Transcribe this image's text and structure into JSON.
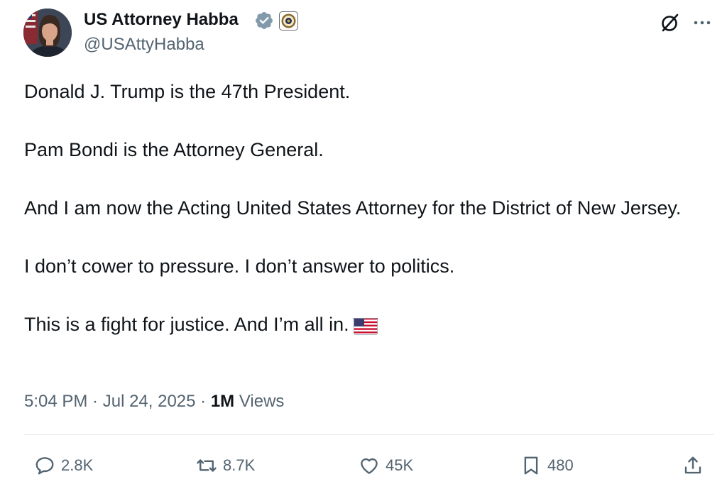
{
  "author": {
    "display_name": "US Attorney Habba",
    "handle": "@USAttyHabba"
  },
  "post": {
    "paragraphs": [
      "Donald J. Trump is the 47th President.",
      "Pam Bondi is the Attorney General.",
      "And I am now the Acting United States Attorney for the District of New Jersey.",
      "I don’t cower to pressure. I don’t answer to politics.",
      "This is a fight for justice. And I’m all in."
    ]
  },
  "meta": {
    "time": "5:04 PM",
    "separator": " · ",
    "date": "Jul 24, 2025",
    "views_count": "1M",
    "views_label": "Views"
  },
  "actions": {
    "replies": "2.8K",
    "reposts": "8.7K",
    "likes": "45K",
    "bookmarks": "480"
  },
  "icons": {
    "verified": "verified-badge-icon",
    "affiliation": "doj-seal-icon",
    "grok": "grok-icon",
    "more": "more-icon",
    "flag": "us-flag-icon",
    "reply": "reply-icon",
    "repost": "repost-icon",
    "like": "heart-icon",
    "bookmark": "bookmark-icon",
    "share": "share-icon"
  },
  "colors": {
    "text": "#0f1419",
    "secondary": "#536471",
    "verified": "#829aab",
    "divider": "#e7e9ea"
  }
}
